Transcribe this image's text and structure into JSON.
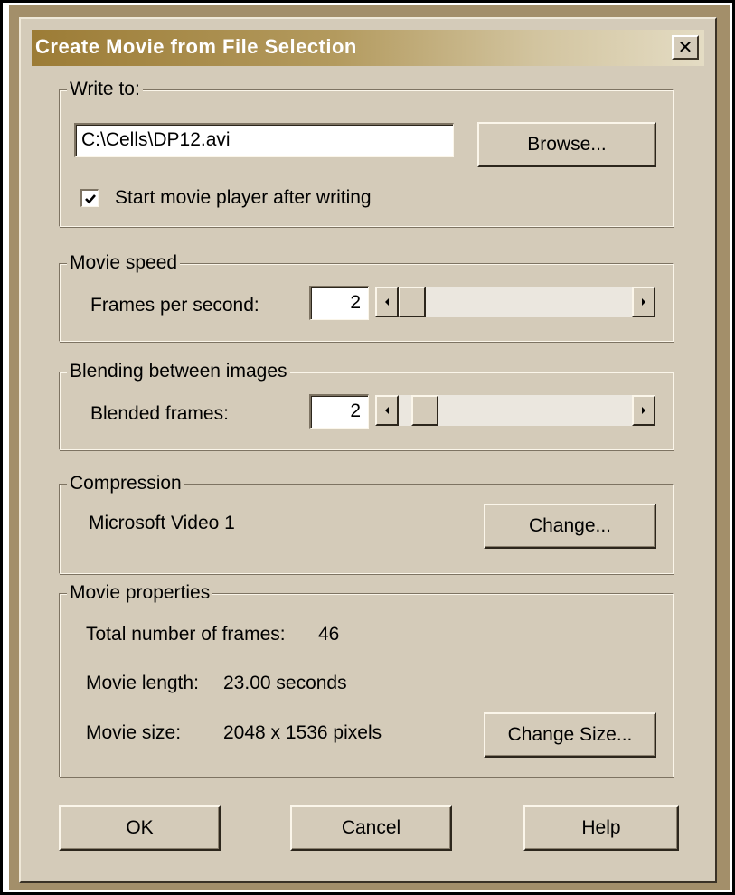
{
  "window": {
    "title": "Create Movie from File Selection",
    "close_glyph": "✕"
  },
  "write_to": {
    "group_label": "Write to:",
    "path_value": "C:\\Cells\\DP12.avi",
    "browse_label": "Browse...",
    "start_player_label": "Start movie player after writing",
    "start_player_checked": true
  },
  "movie_speed": {
    "group_label": "Movie speed",
    "fps_label": "Frames per second:",
    "fps_value": "2"
  },
  "blending": {
    "group_label": "Blending between images",
    "blended_label": "Blended frames:",
    "blended_value": "2"
  },
  "compression": {
    "group_label": "Compression",
    "codec": "Microsoft Video 1",
    "change_label": "Change..."
  },
  "properties": {
    "group_label": "Movie properties",
    "total_frames_label": "Total number of frames:",
    "total_frames_value": "46",
    "length_label": "Movie length:",
    "length_value": "23.00 seconds",
    "size_label": "Movie size:",
    "size_value": "2048 x 1536 pixels",
    "change_size_label": "Change Size..."
  },
  "footer": {
    "ok_label": "OK",
    "cancel_label": "Cancel",
    "help_label": "Help"
  },
  "icons": {
    "check": "check-icon",
    "left_arrow": "arrow-left-icon",
    "right_arrow": "arrow-right-icon",
    "close": "close-icon"
  }
}
